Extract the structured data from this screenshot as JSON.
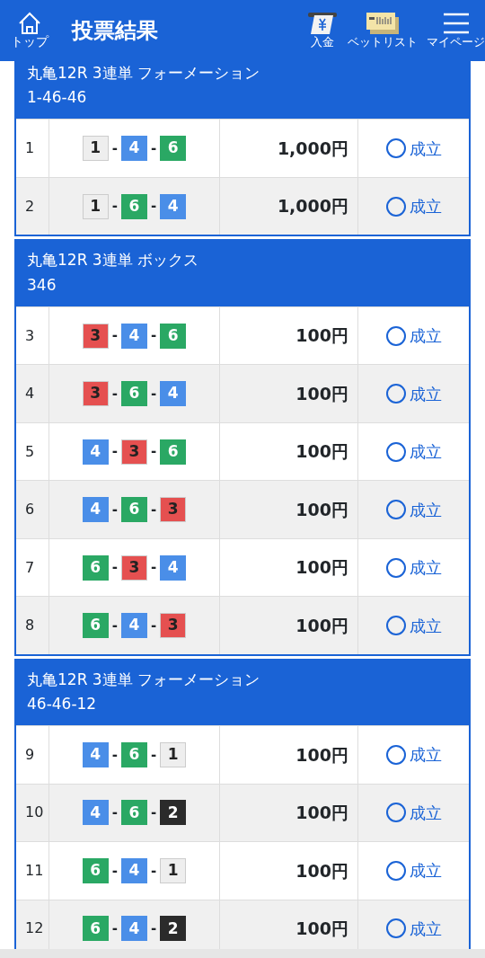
{
  "header": {
    "home_label": "トップ",
    "title": "投票結果",
    "actions": [
      {
        "kind": "deposit",
        "label": "入金"
      },
      {
        "kind": "betlist",
        "label": "ベットリスト"
      },
      {
        "kind": "menu",
        "label": "マイページ"
      }
    ]
  },
  "sections": [
    {
      "title": "丸亀12R 3連単 フォーメーション",
      "combo": "1-46-46",
      "rows": [
        {
          "no": "1",
          "picks": [
            {
              "num": "1",
              "color": "#eeeeee"
            },
            {
              "num": "4",
              "color": "#4a8ee8"
            },
            {
              "num": "6",
              "color": "#2aa864"
            }
          ],
          "separators": [
            "-",
            "-"
          ],
          "amount": "1,000円",
          "status": "成立"
        },
        {
          "no": "2",
          "picks": [
            {
              "num": "1",
              "color": "#eeeeee"
            },
            {
              "num": "6",
              "color": "#2aa864"
            },
            {
              "num": "4",
              "color": "#4a8ee8"
            }
          ],
          "separators": [
            "-",
            "-"
          ],
          "amount": "1,000円",
          "status": "成立"
        }
      ]
    },
    {
      "title": "丸亀12R 3連単 ボックス",
      "combo": "346",
      "rows": [
        {
          "no": "3",
          "picks": [
            {
              "num": "3",
              "color": "#e55050"
            },
            {
              "num": "4",
              "color": "#4a8ee8"
            },
            {
              "num": "6",
              "color": "#2aa864"
            }
          ],
          "separators": [
            "-",
            "-"
          ],
          "amount": "100円",
          "status": "成立"
        },
        {
          "no": "4",
          "picks": [
            {
              "num": "3",
              "color": "#e55050"
            },
            {
              "num": "6",
              "color": "#2aa864"
            },
            {
              "num": "4",
              "color": "#4a8ee8"
            }
          ],
          "separators": [
            "-",
            "-"
          ],
          "amount": "100円",
          "status": "成立"
        },
        {
          "no": "5",
          "picks": [
            {
              "num": "4",
              "color": "#4a8ee8"
            },
            {
              "num": "3",
              "color": "#e55050"
            },
            {
              "num": "6",
              "color": "#2aa864"
            }
          ],
          "separators": [
            "-",
            "-"
          ],
          "amount": "100円",
          "status": "成立"
        },
        {
          "no": "6",
          "picks": [
            {
              "num": "4",
              "color": "#4a8ee8"
            },
            {
              "num": "6",
              "color": "#2aa864"
            },
            {
              "num": "3",
              "color": "#e55050"
            }
          ],
          "separators": [
            "-",
            "-"
          ],
          "amount": "100円",
          "status": "成立"
        },
        {
          "no": "7",
          "picks": [
            {
              "num": "6",
              "color": "#2aa864"
            },
            {
              "num": "3",
              "color": "#e55050"
            },
            {
              "num": "4",
              "color": "#4a8ee8"
            }
          ],
          "separators": [
            "-",
            "-"
          ],
          "amount": "100円",
          "status": "成立"
        },
        {
          "no": "8",
          "picks": [
            {
              "num": "6",
              "color": "#2aa864"
            },
            {
              "num": "4",
              "color": "#4a8ee8"
            },
            {
              "num": "3",
              "color": "#e55050"
            }
          ],
          "separators": [
            "-",
            "-"
          ],
          "amount": "100円",
          "status": "成立"
        }
      ]
    },
    {
      "title": "丸亀12R 3連単 フォーメーション",
      "combo": "46-46-12",
      "rows": [
        {
          "no": "9",
          "picks": [
            {
              "num": "4",
              "color": "#4a8ee8"
            },
            {
              "num": "6",
              "color": "#2aa864"
            },
            {
              "num": "1",
              "color": "#eeeeee"
            }
          ],
          "separators": [
            "-",
            "-"
          ],
          "amount": "100円",
          "status": "成立"
        },
        {
          "no": "10",
          "picks": [
            {
              "num": "4",
              "color": "#4a8ee8"
            },
            {
              "num": "6",
              "color": "#2aa864"
            },
            {
              "num": "2",
              "color": "#2b2b2b"
            }
          ],
          "separators": [
            "-",
            "-"
          ],
          "amount": "100円",
          "status": "成立"
        },
        {
          "no": "11",
          "picks": [
            {
              "num": "6",
              "color": "#2aa864"
            },
            {
              "num": "4",
              "color": "#4a8ee8"
            },
            {
              "num": "1",
              "color": "#eeeeee"
            }
          ],
          "separators": [
            "-",
            "-"
          ],
          "amount": "100円",
          "status": "成立"
        },
        {
          "no": "12",
          "picks": [
            {
              "num": "6",
              "color": "#2aa864"
            },
            {
              "num": "4",
              "color": "#4a8ee8"
            },
            {
              "num": "2",
              "color": "#2b2b2b"
            }
          ],
          "separators": [
            "-",
            "-"
          ],
          "amount": "100円",
          "status": "成立"
        }
      ]
    }
  ]
}
